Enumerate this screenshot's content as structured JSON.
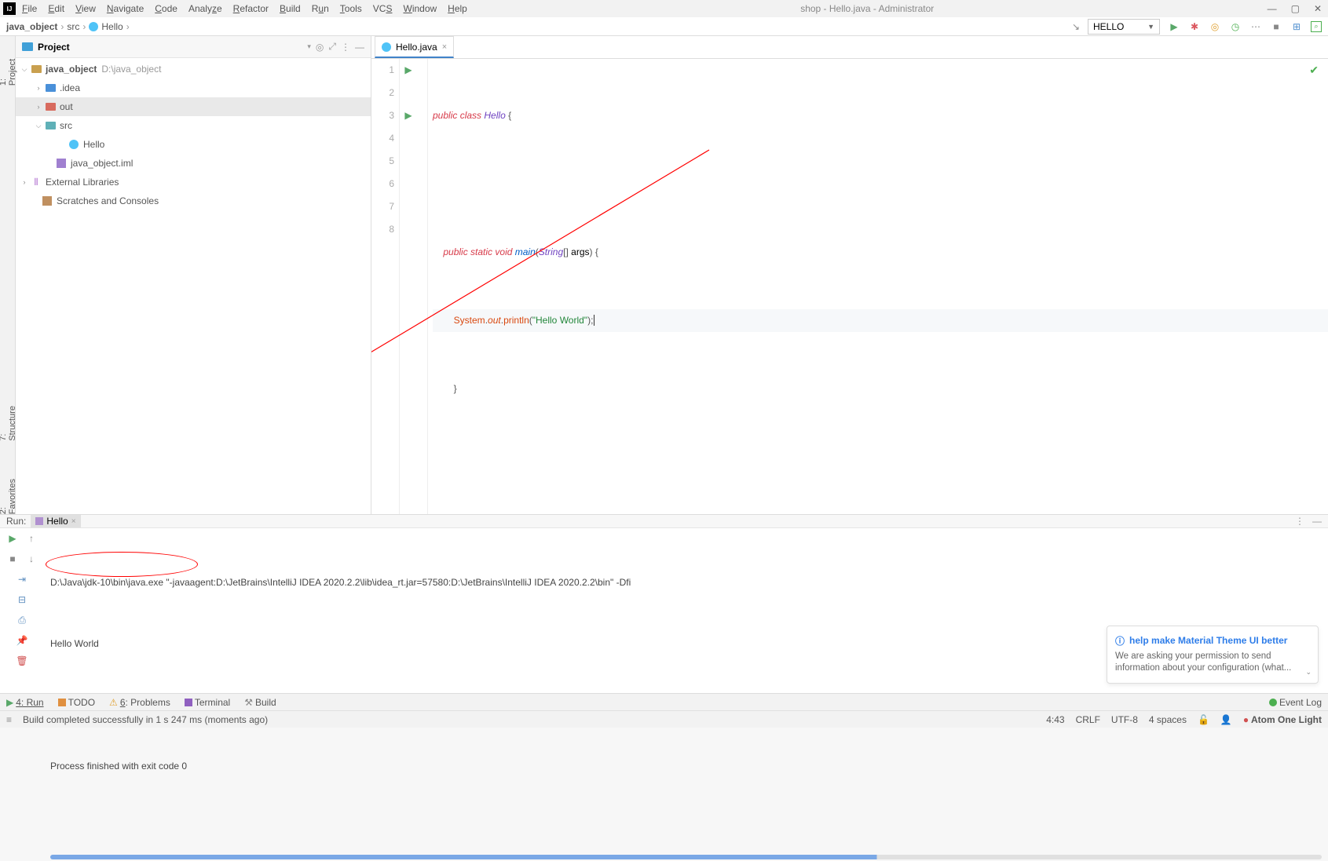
{
  "menu": [
    "File",
    "Edit",
    "View",
    "Navigate",
    "Code",
    "Analyze",
    "Refactor",
    "Build",
    "Run",
    "Tools",
    "VCS",
    "Window",
    "Help"
  ],
  "window_title": "shop - Hello.java - Administrator",
  "breadcrumb": {
    "project": "java_object",
    "mid": "src",
    "leaf": "Hello"
  },
  "run_config_selected": "HELLO",
  "left_tabs": {
    "project": "1: Project",
    "structure": "7: Structure",
    "favorites": "2: Favorites"
  },
  "project_panel": {
    "title": "Project",
    "tree": {
      "root": "java_object",
      "root_path": "D:\\java_object",
      "idea": ".idea",
      "out": "out",
      "src": "src",
      "hello": "Hello",
      "iml": "java_object.iml",
      "ext_lib": "External Libraries",
      "scratch": "Scratches and Consoles"
    }
  },
  "editor": {
    "tab": "Hello.java",
    "lines": [
      "1",
      "2",
      "3",
      "4",
      "5",
      "6",
      "7",
      "8"
    ],
    "code": {
      "l1": {
        "kw1": "public",
        "kw2": "class",
        "cls": "Hello",
        "tail": " {"
      },
      "l3": {
        "indent": "    ",
        "kw1": "public",
        "kw2": "static",
        "kw3": "void",
        "meth": "main",
        "p1": "(",
        "type": "String",
        "arr": "[]",
        "arg": " args",
        "p2": ")",
        "tail": " {"
      },
      "l4": {
        "indent": "        ",
        "sys": "System",
        "d1": ".",
        "out": "out",
        "d2": ".",
        "pl": "println",
        "p1": "(",
        "str": "\"Hello World\"",
        "p2": ")",
        "sc": ";"
      },
      "l5": "        }",
      "l7": "}"
    }
  },
  "run_panel": {
    "title": "Run:",
    "tab": "Hello",
    "console": {
      "cmd": "D:\\Java\\jdk-10\\bin\\java.exe \"-javaagent:D:\\JetBrains\\IntelliJ IDEA 2020.2.2\\lib\\idea_rt.jar=57580:D:\\JetBrains\\IntelliJ IDEA 2020.2.2\\bin\" -Dfi",
      "out1": "Hello World",
      "exit": "Process finished with exit code 0"
    }
  },
  "notification": {
    "title": "help make Material Theme UI better",
    "body": "We are asking your permission to send information about your configuration (what..."
  },
  "bottom_tools": {
    "run": "4: Run",
    "todo": "TODO",
    "problems": "6: Problems",
    "terminal": "Terminal",
    "build": "Build",
    "event_log": "Event Log"
  },
  "status": {
    "build_msg": "Build completed successfully in 1 s 247 ms (moments ago)",
    "pos": "4:43",
    "sep": "CRLF",
    "enc": "UTF-8",
    "indent": "4 spaces",
    "theme": "Atom One Light"
  }
}
